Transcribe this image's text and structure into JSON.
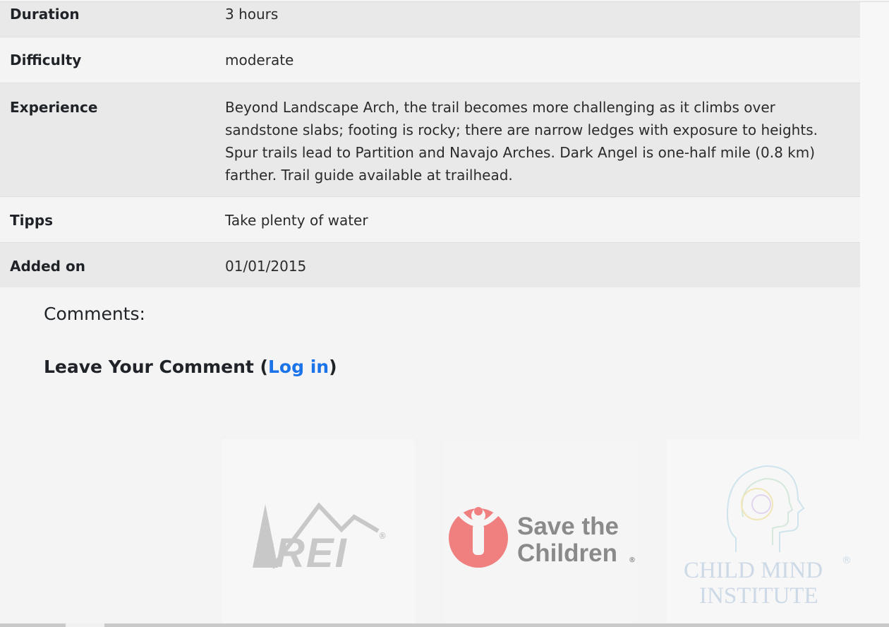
{
  "details": {
    "rows": [
      {
        "key": "Duration",
        "value": "3 hours"
      },
      {
        "key": "Difficulty",
        "value": "moderate"
      },
      {
        "key": "Experience",
        "value": "Beyond Landscape Arch, the trail becomes more challenging as it climbs over sandstone slabs; footing is rocky; there are narrow ledges with exposure to heights. Spur trails lead to Partition and Navajo Arches. Dark Angel is one-half mile (0.8 km) farther. Trail guide available at trailhead."
      },
      {
        "key": "Tipps",
        "value": "Take plenty of water"
      },
      {
        "key": "Added on",
        "value": "01/01/2015"
      }
    ]
  },
  "comments": {
    "title": "Comments:",
    "leave_prefix": "Leave Your Comment (",
    "login_link": "Log in",
    "leave_suffix": ")"
  },
  "sponsors": {
    "rei": {
      "name": "REI",
      "registered": "®",
      "color": "#c8c8c8"
    },
    "save_the_children": {
      "line1": "Save the",
      "line2": "Children",
      "registered": "®",
      "text_color": "#8a8a8a",
      "emblem_color": "#f08080"
    },
    "child_mind": {
      "line1": "CHILD MIND",
      "line2": "INSTITUTE",
      "registered": "®",
      "text_color": "#cdd9e6"
    }
  },
  "colors": {
    "link": "#1a73e8",
    "row_odd": "#e9e9e9",
    "row_even": "#f4f4f4"
  }
}
